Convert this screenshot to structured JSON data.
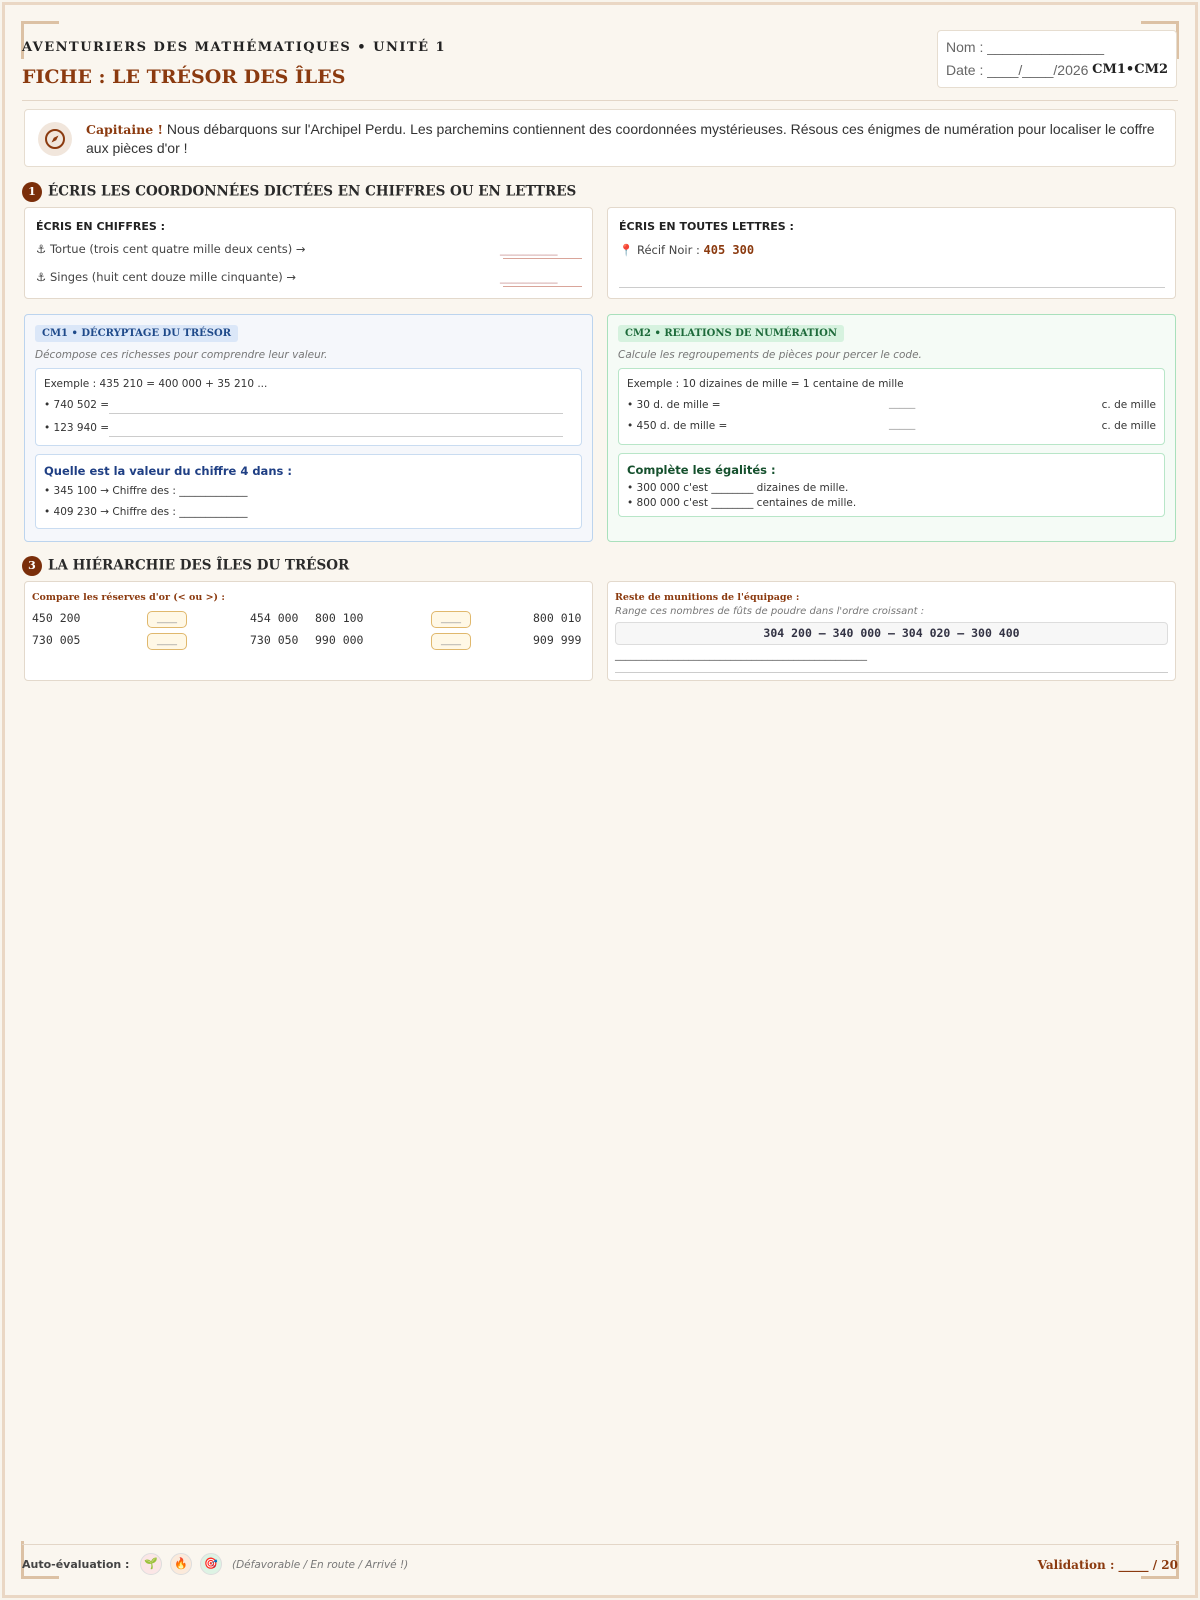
{
  "header": {
    "series_title": "AVENTURIERS DES MATHÉMATIQUES • UNITÉ 1",
    "sheet_title": "FICHE : LE TRÉSOR DES ÎLES",
    "nom_label": "Nom : _______________",
    "date_label": "Date : ____/____/2026",
    "level": "CM1•CM2"
  },
  "intro": {
    "captain": "Capitaine !",
    "text": " Nous débarquons sur l'Archipel Perdu. Les parchemins contiennent des coordonnées mystérieuses. Résous ces énigmes de numération pour localiser le coffre aux pièces d'or !",
    "icon": "compass-icon"
  },
  "section1": {
    "number": "1",
    "title": "ÉCRIS LES COORDONNÉES DICTÉES EN CHIFFRES OU EN LETTRES",
    "left": {
      "heading": "ÉCRIS EN CHIFFRES :",
      "items": [
        "⚓ Tortue (trois cent quatre mille deux cents) →",
        "⚓ Singes (huit cent douze mille cinquante) →"
      ],
      "blank": "__________"
    },
    "right": {
      "heading": "ÉCRIS EN TOUTES LETTRES :",
      "item_label": "📍 Récif Noir : ",
      "item_value": "405 300"
    }
  },
  "cm1": {
    "tag": "CM1 • DÉCRYPTAGE DU TRÉSOR",
    "hint": "Décompose ces richesses pour comprendre leur valeur.",
    "example": "Exemple : 435 210 = 400 000 + 35 210 ...",
    "items": [
      "• 740 502 =",
      "• 123 940 ="
    ],
    "blank": "______________________________",
    "value_heading": "Quelle est la valeur du chiffre 4 dans :",
    "value_items": [
      "• 345 100 → Chiffre des : _____________",
      "• 409 230 → Chiffre des : _____________"
    ]
  },
  "cm2": {
    "tag": "CM2 • RELATIONS DE NUMÉRATION",
    "hint": "Calcule les regroupements de pièces pour percer le code.",
    "example": "Exemple : 10 dizaines de mille = 1 centaine de mille",
    "items": [
      {
        "label": "• 30 d. de mille =",
        "blank": "_____",
        "unit": "c. de mille"
      },
      {
        "label": "• 450 d. de mille =",
        "blank": "_____",
        "unit": "c. de mille"
      }
    ],
    "eq_heading": "Complète les égalités :",
    "eq_items": [
      "• 300 000 c'est ________ dizaines de mille.",
      "• 800 000 c'est ________ centaines de mille."
    ]
  },
  "section3": {
    "number": "3",
    "title": "LA HIÉRARCHIE DES ÎLES DU TRÉSOR",
    "compare": {
      "heading": "Compare les réserves d'or (< ou >) :",
      "rows": [
        [
          {
            "a": "450 200",
            "b": "454 000"
          },
          {
            "a": "800 100",
            "b": "800 010"
          }
        ],
        [
          {
            "a": "730 005",
            "b": "730 050"
          },
          {
            "a": "990 000",
            "b": "909 999"
          }
        ]
      ],
      "box_label": "____"
    },
    "order": {
      "heading": "Reste de munitions de l'équipage :",
      "hint": "Range ces nombres de fûts de poudre dans l'ordre croissant :",
      "numbers": "304 200 – 340 000 – 304 020 – 300 400",
      "blank": "________________________________________________"
    }
  },
  "footer": {
    "label": "Auto-évaluation :",
    "faces": [
      "🌱",
      "🔥",
      "🎯"
    ],
    "hint": "(Défavorable / En route / Arrivé !)",
    "validation": "Validation : _____ / 20"
  }
}
